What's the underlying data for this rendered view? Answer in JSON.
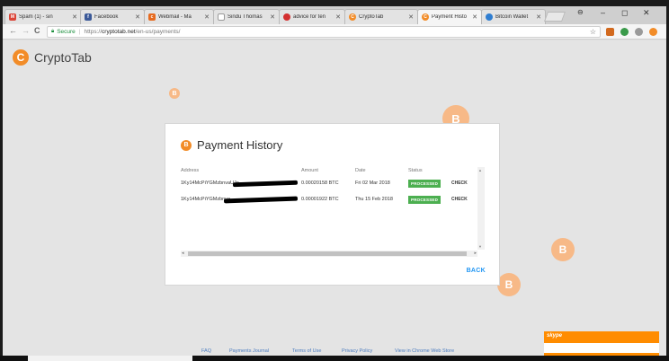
{
  "tabs": [
    {
      "label": "Spam (1) - sin",
      "fav_color": "#db4437",
      "fav_glyph": "M"
    },
    {
      "label": "Facebook",
      "fav_color": "#3b5998",
      "fav_glyph": "f"
    },
    {
      "label": "Webmail - Ma",
      "fav_color": "#e66a1f",
      "fav_glyph": "c"
    },
    {
      "label": "Sindu Thomas",
      "fav_color": "#9e9e9e",
      "fav_glyph": ""
    },
    {
      "label": "advice for ten",
      "fav_color": "#d32f2f",
      "fav_glyph": ""
    },
    {
      "label": "CryptoTab",
      "fav_color": "#f28c28",
      "fav_glyph": "C"
    },
    {
      "label": "Payment Histo",
      "fav_color": "#f28c28",
      "fav_glyph": "C"
    },
    {
      "label": "Bitcoin Wallet",
      "fav_color": "#2e7dd1",
      "fav_glyph": ""
    }
  ],
  "window_controls": {
    "minimize": "–",
    "maximize": "◻",
    "close": "✕"
  },
  "toolbar": {
    "back": "←",
    "forward": "→",
    "reload": "C",
    "secure_label": "Secure",
    "url_scheme": "https://",
    "url_host": "cryptotab.net",
    "url_path": "/en-us/payments/",
    "star": "☆"
  },
  "brand": {
    "logo_glyph": "C",
    "name": "CryptoTab",
    "accent": "#f28c28"
  },
  "payment_history": {
    "title": "Payment History",
    "coin_glyph": "B",
    "columns": {
      "address": "Address",
      "amount": "Amount",
      "date": "Date",
      "status": "Status"
    },
    "rows": [
      {
        "address": "1Ky14McPiYGMzbnvaUJo",
        "amount": "0.00020158 BTC",
        "date": "Fri 02 Mar 2018",
        "status": "PROCESSED",
        "action": "CHECK"
      },
      {
        "address": "1Ky14McPiYGMzbnva",
        "amount": "0.00001922 BTC",
        "date": "Thu 15 Feb 2018",
        "status": "PROCESSED",
        "action": "CHECK"
      }
    ],
    "back_label": "BACK"
  },
  "footer_links": [
    "FAQ",
    "Payments Journal",
    "Terms of Use",
    "Privacy Policy",
    "View in Chrome Web Store"
  ],
  "coin_glyph": "B",
  "skype_label": "skype"
}
